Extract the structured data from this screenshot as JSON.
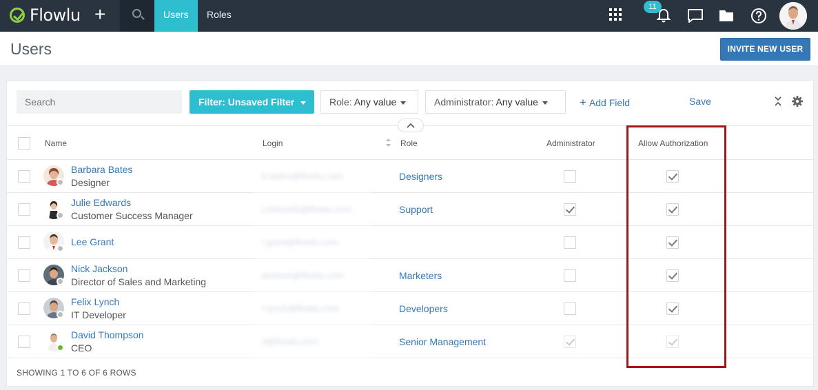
{
  "app": {
    "name": "Flowlu"
  },
  "nav": {
    "plus_label": "+",
    "tabs": [
      {
        "label": "Users",
        "active": true
      },
      {
        "label": "Roles",
        "active": false
      }
    ],
    "notification_count": "11",
    "icons": [
      "apps-grid-icon",
      "bell-icon",
      "chat-icon",
      "folder-icon",
      "help-icon",
      "user-avatar"
    ]
  },
  "page": {
    "title": "Users",
    "invite_button": "INVITE NEW USER"
  },
  "toolbar": {
    "search_placeholder": "Search",
    "filter_label": "Filter: Unsaved Filter",
    "role_filter": {
      "label": "Role:",
      "value": "Any value"
    },
    "admin_filter": {
      "label": "Administrator:",
      "value": "Any value"
    },
    "add_field": "Add Field",
    "save": "Save"
  },
  "table": {
    "columns": [
      "Name",
      "Login",
      "Role",
      "Administrator",
      "Allow Authorization"
    ],
    "rows": [
      {
        "name": "Barbara Bates",
        "position": "Designer",
        "login": "b.bates@flowlu.com",
        "role": "Designers",
        "administrator": false,
        "allow_authorization": true,
        "online": false
      },
      {
        "name": "Julie Edwards",
        "position": "Customer Success Manager",
        "login": "j.edwards@flowlu.com",
        "role": "Support",
        "administrator": true,
        "allow_authorization": true,
        "online": false
      },
      {
        "name": "Lee Grant",
        "position": "",
        "login": "l.grant@flowlu.com",
        "role": "",
        "administrator": false,
        "allow_authorization": true,
        "online": false
      },
      {
        "name": "Nick Jackson",
        "position": "Director of Sales and Marketing",
        "login": "jackson@flowlu.com",
        "role": "Marketers",
        "administrator": false,
        "allow_authorization": true,
        "online": false
      },
      {
        "name": "Felix Lynch",
        "position": "IT Developer",
        "login": "f.lynch@flowlu.com",
        "role": "Developers",
        "administrator": false,
        "allow_authorization": true,
        "online": false
      },
      {
        "name": "David Thompson",
        "position": "CEO",
        "login": "d@flowlu.com",
        "role": "Senior Management",
        "administrator": true,
        "allow_authorization": true,
        "online": true
      }
    ],
    "footer": "SHOWING 1 TO 6 OF 6 ROWS"
  },
  "colors": {
    "topbar": "#2a3440",
    "accent": "#2fbed0",
    "link": "#3578b8",
    "logo_green": "#8cd33f",
    "highlight_box": "#a31518"
  }
}
